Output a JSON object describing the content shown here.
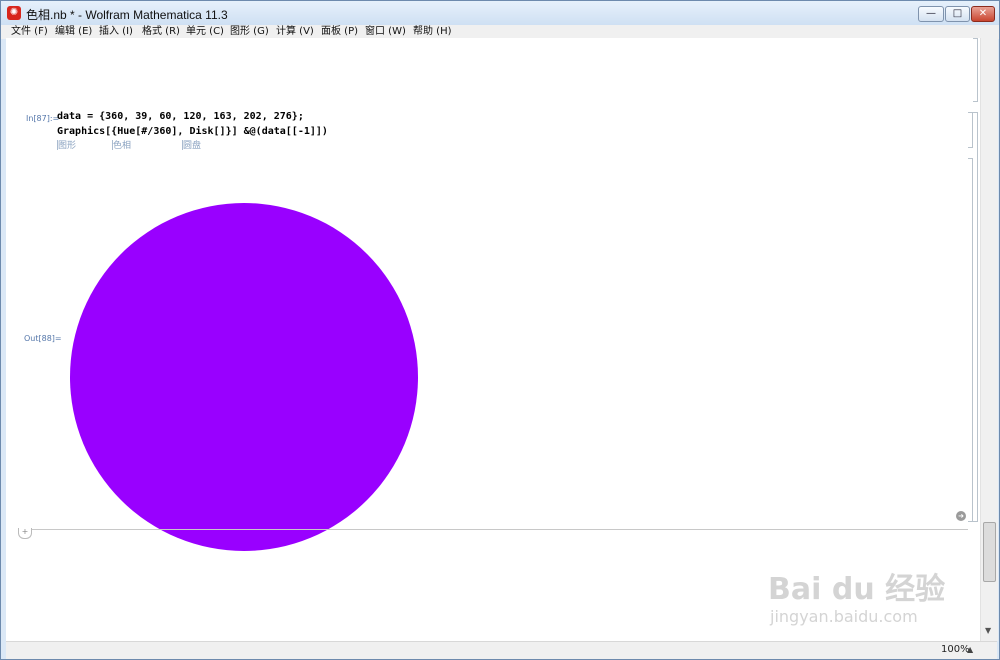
{
  "window": {
    "title": "色相.nb * - Wolfram Mathematica 11.3",
    "app_icon_glyph": "✺",
    "controls": {
      "minimize": "—",
      "maximize": "□",
      "close": "✕"
    }
  },
  "menubar": {
    "items": [
      {
        "label": "文件 (F)"
      },
      {
        "label": "编辑 (E)"
      },
      {
        "label": "插入 (I)"
      },
      {
        "label": "格式 (R)"
      },
      {
        "label": "单元 (C)"
      },
      {
        "label": "图形 (G)"
      },
      {
        "label": "计算 (V)"
      },
      {
        "label": "面板 (P)"
      },
      {
        "label": "窗口 (W)"
      },
      {
        "label": "帮助 (H)"
      }
    ]
  },
  "notebook": {
    "input_cell": {
      "label": "In[87]:=",
      "line1": "data = {360, 39, 60, 120, 163, 202, 276};",
      "line2": "Graphics[{Hue[#/360], Disk[]}] &@(data[[-1]])",
      "hints": [
        "图形",
        "色相",
        "圆盘"
      ]
    },
    "output_cell": {
      "label": "Out[88]=",
      "disk_color": "#9900ff",
      "hue_value": 276
    }
  },
  "statusbar": {
    "zoom": "100%"
  },
  "watermark": {
    "logo": "Bai du 经验",
    "url": "jingyan.baidu.com"
  },
  "colors": {
    "disk": "#9900ff",
    "cell_label": "#5577aa",
    "hint": "#8aa2c0"
  }
}
